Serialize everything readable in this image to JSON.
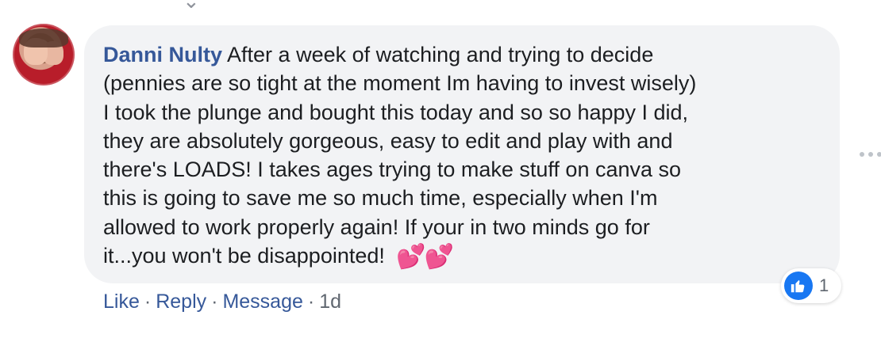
{
  "comment": {
    "author": "Danni Nulty",
    "text_lines": [
      "After a week of watching and trying to decide",
      "(pennies are so tight at the moment Im having to invest wisely)",
      "I took the plunge and bought this today and so so happy I did,",
      "they are absolutely gorgeous, easy to edit and play with and",
      "there's LOADS! I takes ages trying to make stuff on canva so",
      "this is going to save me so much time, especially when I'm",
      "allowed to work properly again! If your in two minds go for",
      "it...you won't be disappointed!"
    ],
    "emoji": "💕💕",
    "emoji_name": "two-hearts-icon"
  },
  "actions": {
    "like": "Like",
    "reply": "Reply",
    "message": "Message",
    "separator": "·",
    "time": "1d"
  },
  "reaction": {
    "icon": "thumbs-up-icon",
    "count": "1",
    "color": "#1877f2"
  },
  "icons": {
    "more": "more-options-icon"
  },
  "colors": {
    "bubble": "#f2f3f5",
    "author_link": "#365899",
    "text": "#1c1e21",
    "muted": "#606770"
  }
}
